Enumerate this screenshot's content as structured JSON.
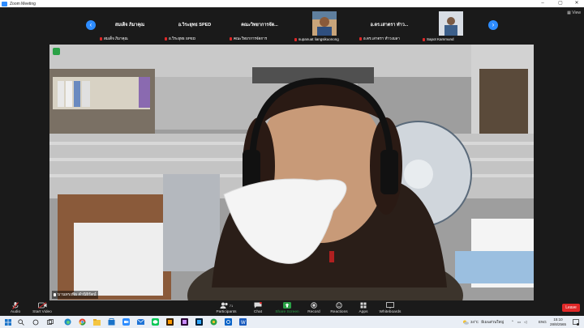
{
  "window": {
    "title": "Zoom Meeting"
  },
  "gallery": {
    "view_label": "View",
    "tiles": [
      {
        "display_name": "สมเด็จ ภิมาคุณ",
        "label": "สมเด็จ ภิมาคุณ",
        "has_video": false
      },
      {
        "display_name": "อ.วิระยุทธ SPED",
        "label": "อ.วิระยุทธ SPED",
        "has_video": false
      },
      {
        "display_name": "คณะวิทยาการจัด...",
        "label": "คณะวิทยาการจัดการ",
        "has_video": false
      },
      {
        "display_name": "",
        "label": "supanuat liangsikuonong",
        "has_video": true
      },
      {
        "display_name": "อ.ดร.เสาตรา ทำว...",
        "label": "อ.ดร.เสาตรา ทำวงมลา",
        "has_video": false
      },
      {
        "display_name": "",
        "label": "Sapot Kammund",
        "has_video": true
      }
    ]
  },
  "main_video": {
    "speaker_label": "บานทรงพิธ คำนิธิรัตน์"
  },
  "toolbar": {
    "audio": "Audio",
    "start_video": "Start Video",
    "participants": "Participants",
    "participants_count": "71",
    "chat": "Chat",
    "share_screen": "Share Screen",
    "record": "Record",
    "reactions": "Reactions",
    "apps": "Apps",
    "whiteboards": "Whiteboards",
    "leave": "Leave"
  },
  "taskbar": {
    "weather": "34°C",
    "weather_desc": "มีเมฆส่วนใหญ่",
    "lang": "ENG",
    "time": "15:10",
    "date": "28/8/2565"
  },
  "colors": {
    "accent": "#2d8cff",
    "leave": "#e02828",
    "share": "#2aa146"
  }
}
